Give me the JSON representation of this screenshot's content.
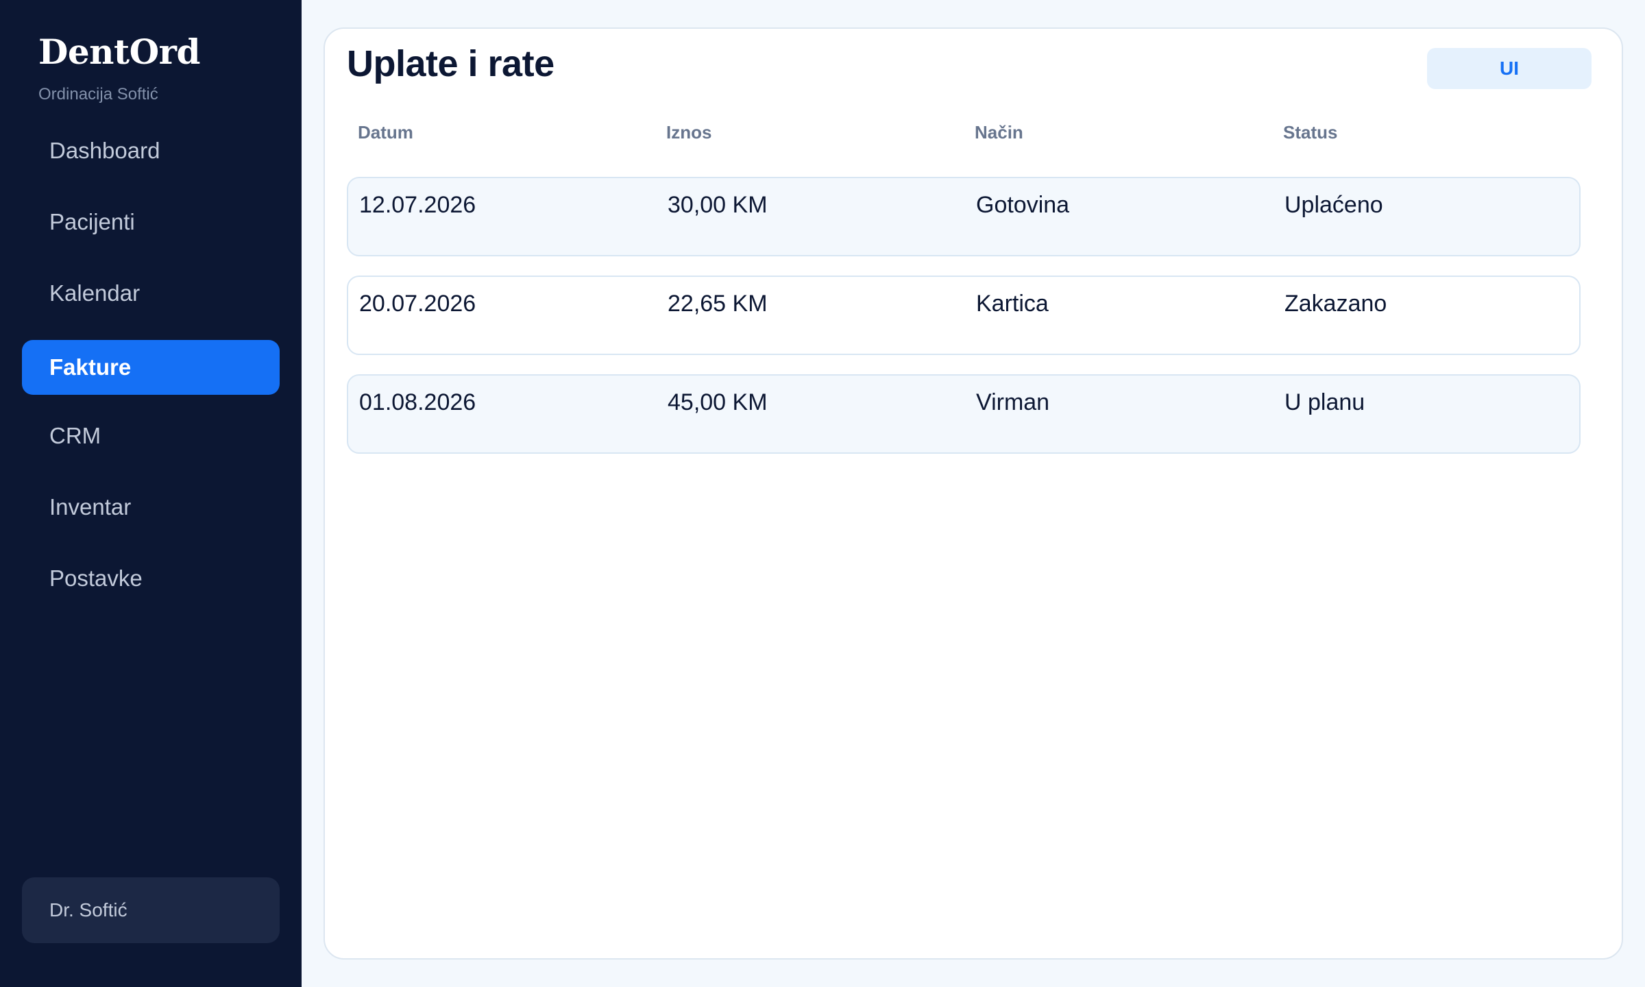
{
  "sidebar": {
    "brand": "DentOrd",
    "subtitle": "Ordinacija Softić",
    "items": [
      {
        "label": "Dashboard"
      },
      {
        "label": "Pacijenti"
      },
      {
        "label": "Kalendar"
      },
      {
        "label": "Fakture",
        "active": true
      },
      {
        "label": "CRM"
      },
      {
        "label": "Inventar"
      },
      {
        "label": "Postavke"
      }
    ],
    "user": "Dr. Softić"
  },
  "main": {
    "title": "Uplate i rate",
    "badge": "UI",
    "columns": [
      "Datum",
      "Iznos",
      "Način",
      "Status"
    ],
    "rows": [
      {
        "datum": "12.07.2026",
        "iznos": "30,00 KM",
        "nacin": "Gotovina",
        "status": "Uplaćeno"
      },
      {
        "datum": "20.07.2026",
        "iznos": "22,65 KM",
        "nacin": "Kartica",
        "status": "Zakazano"
      },
      {
        "datum": "01.08.2026",
        "iznos": "45,00 KM",
        "nacin": "Virman",
        "status": "U planu"
      }
    ]
  },
  "colors": {
    "sidebar_bg": "#0c1733",
    "accent": "#1570f5",
    "page_bg": "#f3f8fd",
    "text_dark": "#0c1733"
  }
}
